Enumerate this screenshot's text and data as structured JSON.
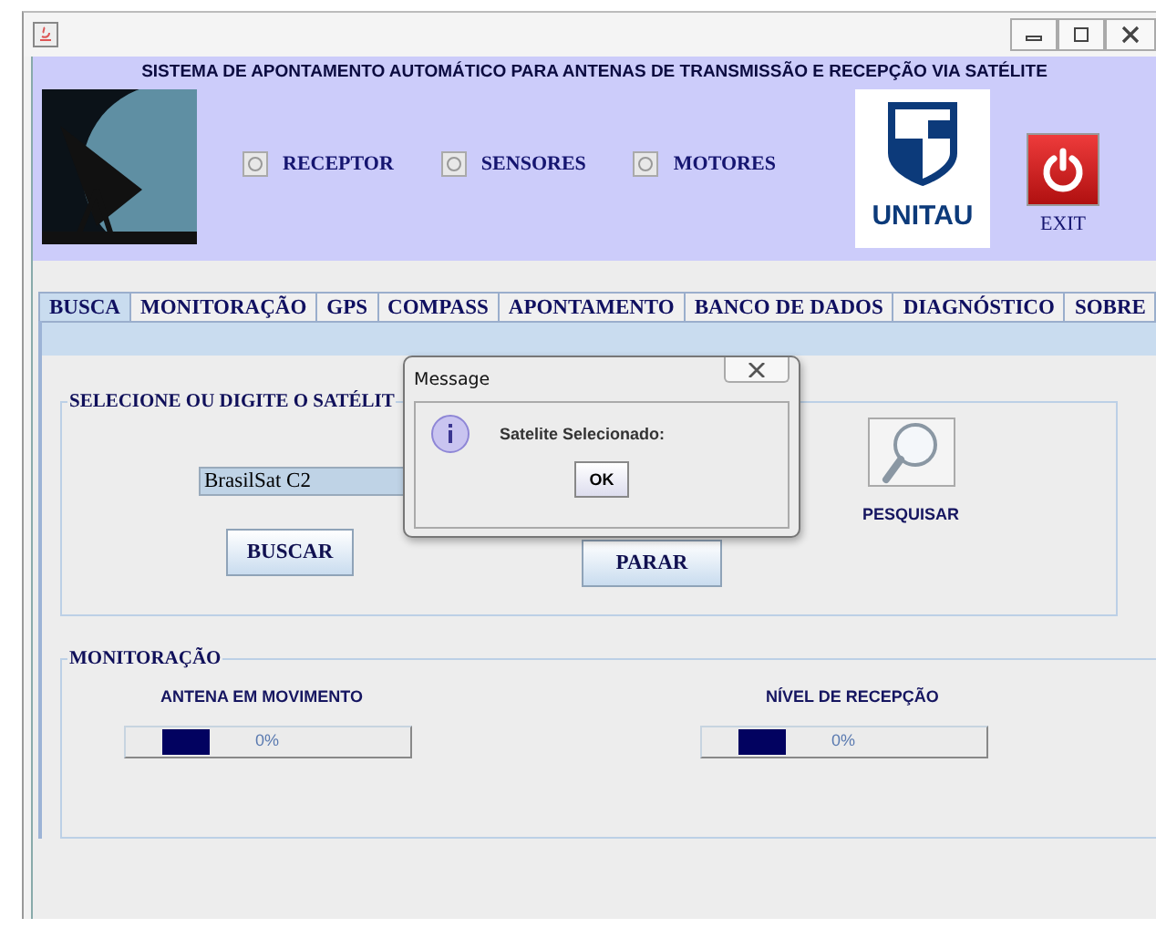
{
  "header": {
    "title": "SISTEMA DE APONTAMENTO AUTOMÁTICO PARA ANTENAS DE TRANSMISSÃO E RECEPÇÃO VIA SATÉLITE",
    "indicators": [
      {
        "label": "RECEPTOR",
        "selected": false
      },
      {
        "label": "SENSORES",
        "selected": false
      },
      {
        "label": "MOTORES",
        "selected": false
      }
    ],
    "logo_text": "UNITAU",
    "exit_label": "EXIT"
  },
  "tabs": [
    {
      "label": "BUSCA",
      "selected": true
    },
    {
      "label": "MONITORAÇÃO",
      "selected": false
    },
    {
      "label": "GPS",
      "selected": false
    },
    {
      "label": "COMPASS",
      "selected": false
    },
    {
      "label": "APONTAMENTO",
      "selected": false
    },
    {
      "label": "BANCO DE DADOS",
      "selected": false
    },
    {
      "label": "DIAGNÓSTICO",
      "selected": false
    },
    {
      "label": "SOBRE",
      "selected": false
    }
  ],
  "search_group": {
    "title": "SELECIONE OU DIGITE O SATÉLIT",
    "satellite": "BrasilSat C2",
    "buttons": [
      "BUSCAR",
      "PARAR"
    ],
    "search_label": "PESQUISAR"
  },
  "monitor_group": {
    "title": "MONITORAÇÃO",
    "meters": [
      {
        "label": "ANTENA EM MOVIMENTO",
        "reading": "0%",
        "indeterminate": true
      },
      {
        "label": "NÍVEL DE RECEPÇÃO",
        "reading": "0%",
        "indeterminate": true
      }
    ]
  },
  "dialog": {
    "title": "Message",
    "message": "Satelite Selecionado:",
    "button": "OK"
  }
}
